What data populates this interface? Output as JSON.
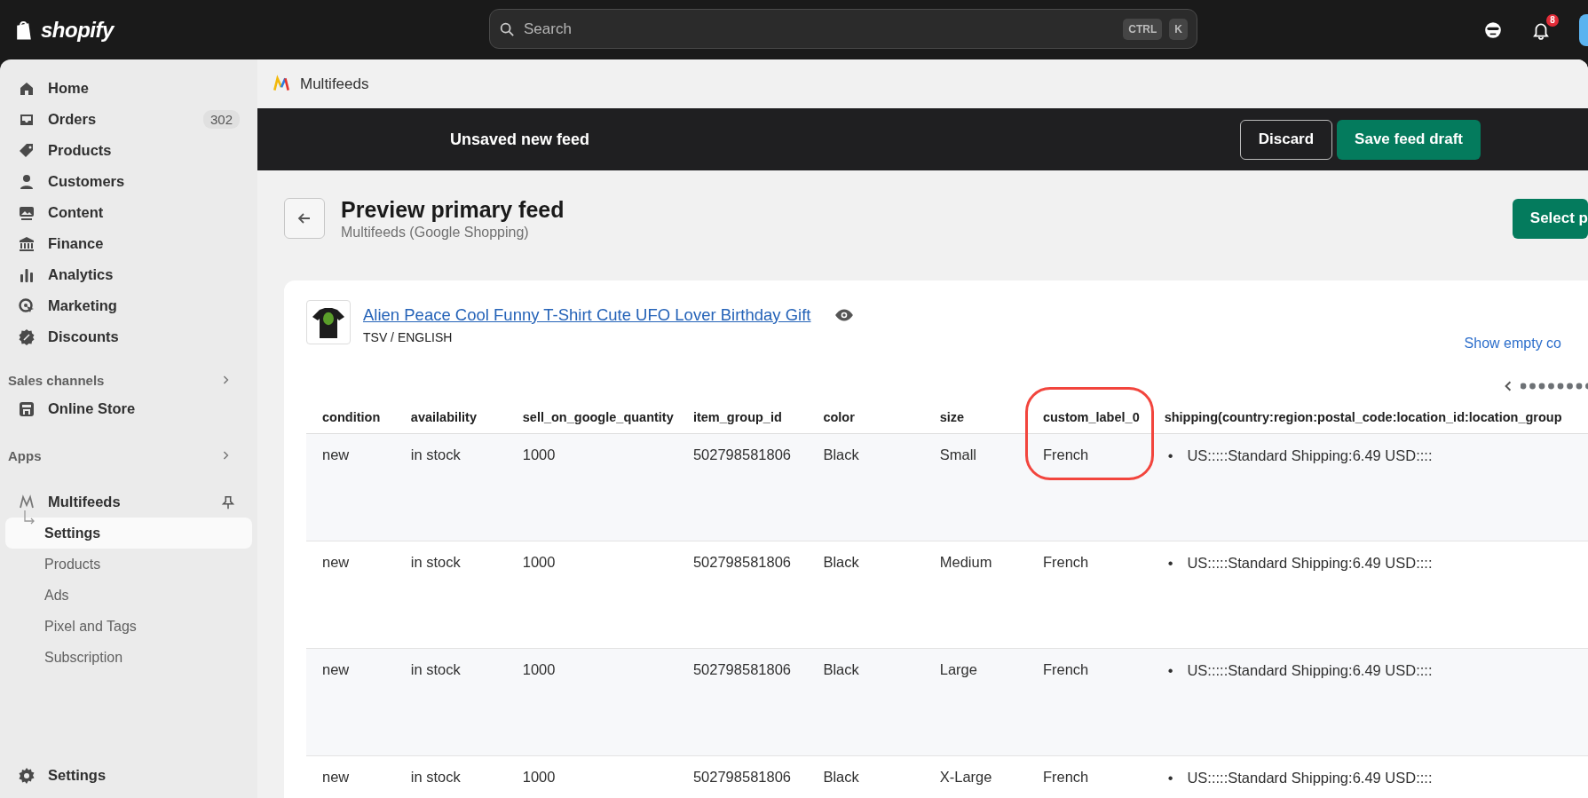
{
  "topbar": {
    "logo": "shopify",
    "search": {
      "placeholder": "Search",
      "keys": [
        "CTRL",
        "K"
      ]
    },
    "notifications": "8"
  },
  "sidebar": {
    "items": [
      {
        "label": "Home",
        "selected": false
      },
      {
        "label": "Orders",
        "badge": "302",
        "selected": false
      },
      {
        "label": "Products",
        "selected": false
      },
      {
        "label": "Customers",
        "selected": false
      },
      {
        "label": "Content",
        "selected": false
      },
      {
        "label": "Finance",
        "selected": false
      },
      {
        "label": "Analytics",
        "selected": false
      },
      {
        "label": "Marketing",
        "selected": false
      },
      {
        "label": "Discounts",
        "selected": false
      }
    ],
    "sections": [
      {
        "title": "Sales channels",
        "items": [
          {
            "label": "Online Store"
          }
        ]
      },
      {
        "title": "Apps"
      }
    ],
    "app": {
      "label": "Multifeeds",
      "children": [
        {
          "label": "Settings",
          "selected": true
        },
        {
          "label": "Products",
          "selected": false
        },
        {
          "label": "Ads",
          "selected": false
        },
        {
          "label": "Pixel and Tags",
          "selected": false
        },
        {
          "label": "Subscription",
          "selected": false
        }
      ]
    },
    "footer": "Settings"
  },
  "app_header": {
    "title": "Multifeeds"
  },
  "save_bar": {
    "title": "Unsaved new feed",
    "buttons": [
      "Discard",
      "Save feed draft"
    ]
  },
  "page": {
    "title": "Preview primary feed",
    "subtitle": "Multifeeds (Google Shopping)",
    "action": "Select p"
  },
  "product": {
    "title": "Alien Peace Cool Funny T-Shirt Cute UFO Lover Birthday Gift",
    "format": "TSV / ENGLISH",
    "show_empty": "Show empty co"
  },
  "table": {
    "columns": [
      {
        "label": "condition",
        "highlighted": false
      },
      {
        "label": "availability",
        "highlighted": false
      },
      {
        "label": "sell_on_google_quantity",
        "highlighted": false
      },
      {
        "label": "item_group_id",
        "highlighted": false
      },
      {
        "label": "color",
        "highlighted": false
      },
      {
        "label": "size",
        "highlighted": false
      },
      {
        "label": "custom_label_0",
        "highlighted": true
      },
      {
        "label": "shipping(country:region:postal_code:location_id:location_group",
        "highlighted": false
      }
    ],
    "rows": [
      {
        "cells": [
          "new",
          "in stock",
          "1000",
          "502798581806",
          "Black",
          "Small",
          "French"
        ],
        "shipping": [
          {
            "bullet": "•",
            "text": "US:::::Standard Shipping:6.49 USD::::"
          }
        ]
      },
      {
        "cells": [
          "new",
          "in stock",
          "1000",
          "502798581806",
          "Black",
          "Medium",
          "French"
        ],
        "shipping": [
          {
            "bullet": "•",
            "text": "US:::::Standard Shipping:6.49 USD::::"
          }
        ]
      },
      {
        "cells": [
          "new",
          "in stock",
          "1000",
          "502798581806",
          "Black",
          "Large",
          "French"
        ],
        "shipping": [
          {
            "bullet": "•",
            "text": "US:::::Standard Shipping:6.49 USD::::"
          }
        ]
      },
      {
        "cells": [
          "new",
          "in stock",
          "1000",
          "502798581806",
          "Black",
          "X-Large",
          "French"
        ],
        "shipping": [
          {
            "bullet": "•",
            "text": "US:::::Standard Shipping:6.49 USD::::"
          }
        ]
      }
    ]
  }
}
